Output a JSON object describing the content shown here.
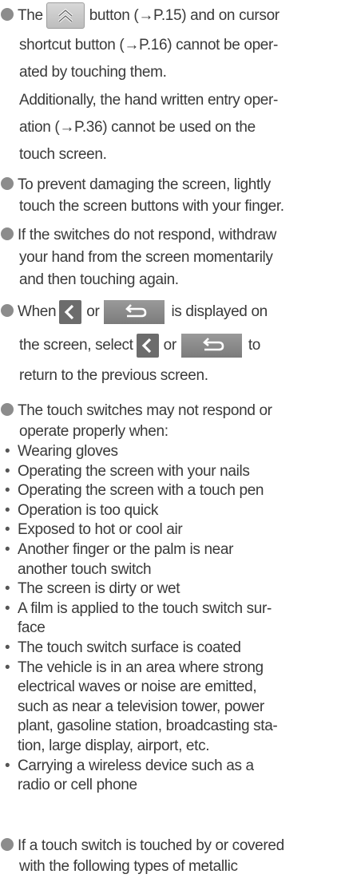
{
  "item1": {
    "line1_before": "The",
    "line1_after": "button (→P.15) and on cursor",
    "line2": "shortcut button (→P.16) cannot be oper-",
    "line3": "ated by touching them.",
    "line4": "Additionally, the hand written entry oper-",
    "line5": "ation (→P.36) cannot be used on the",
    "line6": "touch screen."
  },
  "item2": {
    "line1": "To prevent damaging the screen, lightly",
    "line2": "touch the screen buttons with your finger."
  },
  "item3": {
    "line1": "If the switches do not respond, withdraw",
    "line2": "your hand from the screen momentarily",
    "line3": "and then touching again."
  },
  "item4": {
    "line1_a": "When",
    "line1_b": "or",
    "line1_c": "is displayed on",
    "line2_a": "the screen, select",
    "line2_b": "or",
    "line2_c": "to",
    "line3": "return to the previous screen."
  },
  "item5": {
    "line1": "The touch switches may not respond or",
    "line2": "operate properly when:",
    "sub_items": [
      "Wearing gloves",
      "Operating the screen with your nails",
      "Operating the screen with a touch pen",
      "Operation is too quick",
      "Exposed to hot or cool air",
      "Another finger or the palm is near",
      "another touch switch",
      "The screen is dirty or wet",
      "A film is applied to the touch switch sur-",
      "face",
      "The touch switch surface is coated",
      "The vehicle is in an area where strong",
      "electrical waves or noise are emitted,",
      "such as near a television tower, power",
      "plant, gasoline station, broadcasting sta-",
      "tion, large display, airport, etc.",
      "Carrying a wireless device such as a",
      "radio or cell phone"
    ]
  },
  "item6": {
    "line1": "If a touch switch is touched by or covered",
    "line2": "with the following types of metallic"
  },
  "bullet_char": "•",
  "icons": {
    "up": "double-chevron-up-icon",
    "back": "chevron-left-icon",
    "return": "return-arrow-icon"
  },
  "colors": {
    "bullet": "#8c8c8c",
    "text": "#3a3a3a"
  }
}
